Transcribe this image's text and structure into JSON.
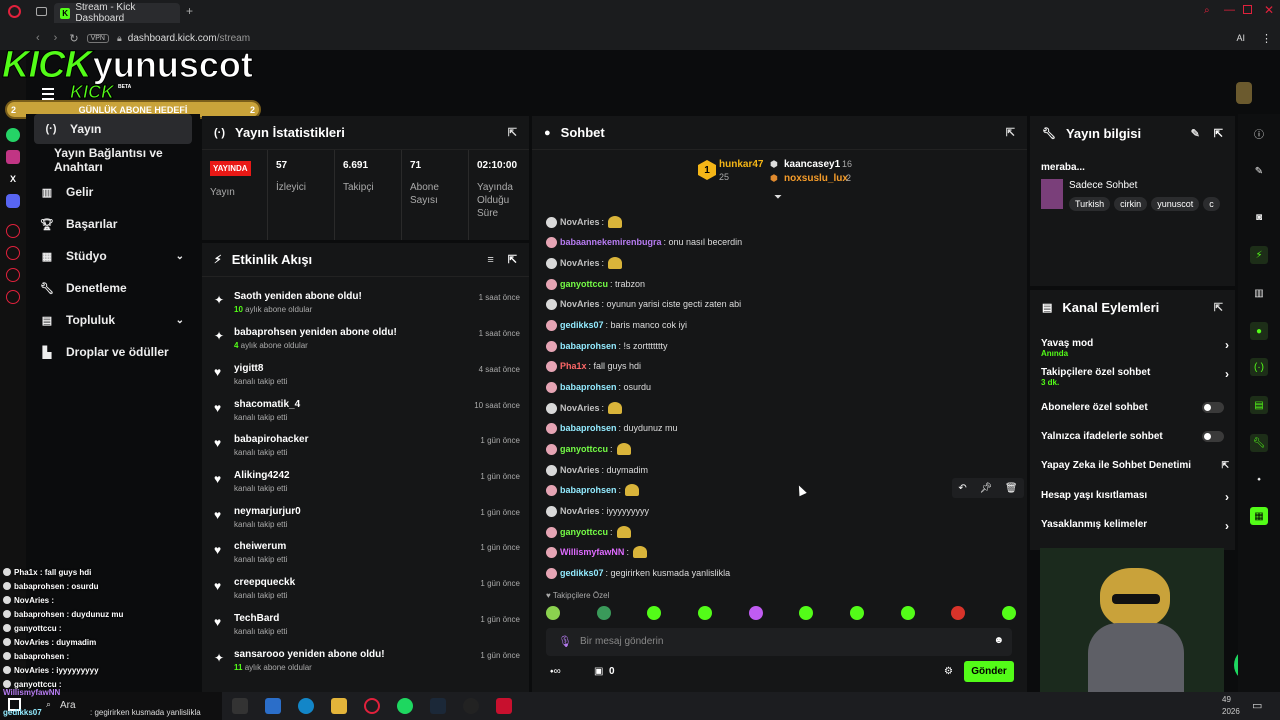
{
  "browser": {
    "tab_title": "Stream - Kick Dashboard",
    "tab_favicon": "K",
    "url_domain": "dashboard.kick.com",
    "url_path": "/stream",
    "vpn_badge": "VPN",
    "ai_label": "AI"
  },
  "overlay": {
    "brand": "KICK",
    "username": "yunuscot",
    "beta": "BETA",
    "goal_label": "GÜNLÜK ABONE HEDEFİ",
    "goal_left": "2",
    "goal_right": "2",
    "chat": [
      {
        "user": "Pha1x",
        "text": ": fall guys hdi",
        "color": "#ffffff"
      },
      {
        "user": "babaprohsen",
        "text": ": osurdu",
        "color": "#ffffff"
      },
      {
        "user": "NovAries",
        "text": ":",
        "color": "#ffffff"
      },
      {
        "user": "babaprohsen",
        "text": ": duydunuz mu",
        "color": "#ffffff"
      },
      {
        "user": "ganyottccu",
        "text": ":",
        "color": "#ffffff"
      },
      {
        "user": "NovAries",
        "text": ": duymadim",
        "color": "#ffffff"
      },
      {
        "user": "babaprohsen",
        "text": ":",
        "color": "#ffffff"
      },
      {
        "user": "NovAries",
        "text": ": iyyyyyyyyy",
        "color": "#ffffff"
      },
      {
        "user": "ganyottccu",
        "text": ":",
        "color": "#ffffff"
      }
    ]
  },
  "nav": {
    "items": [
      {
        "label": "Yayın",
        "icon": "broadcast-icon"
      },
      {
        "label": "Yayın Bağlantısı ve Anahtarı",
        "icon": ""
      },
      {
        "label": "Gelir",
        "icon": "revenue-icon"
      },
      {
        "label": "Başarılar",
        "icon": "trophy-icon"
      },
      {
        "label": "Stüdyo",
        "icon": "studio-icon"
      },
      {
        "label": "Denetleme",
        "icon": "wrench-icon"
      },
      {
        "label": "Topluluk",
        "icon": "community-icon"
      },
      {
        "label": "Droplar ve ödüller",
        "icon": "drops-icon"
      }
    ]
  },
  "stats": {
    "title": "Yayın İstatistikleri",
    "live_badge": "YAYINDA",
    "live_label": "Yayın",
    "viewers_value": "57",
    "viewers_label": "İzleyici",
    "followers_value": "6.691",
    "followers_label": "Takipçi",
    "subs_value": "71",
    "subs_label": "Abone Sayısı",
    "uptime_value": "02:10:00",
    "uptime_label": "Yayında Olduğu Süre"
  },
  "activity": {
    "title": "Etkinlik Akışı",
    "items": [
      {
        "title": "Saoth yeniden abone oldu!",
        "num": "10",
        "sub": " aylık abone oldular",
        "time": "1 saat önce",
        "icon": "sparkle-icon"
      },
      {
        "title": "babaprohsen yeniden abone oldu!",
        "num": "4",
        "sub": " aylık abone oldular",
        "time": "1 saat önce",
        "icon": "sparkle-icon"
      },
      {
        "title": "yigitt8",
        "num": "",
        "sub": "kanalı takip etti",
        "time": "4 saat önce",
        "icon": "heart-icon"
      },
      {
        "title": "shacomatik_4",
        "num": "",
        "sub": "kanalı takip etti",
        "time": "10 saat önce",
        "icon": "heart-icon"
      },
      {
        "title": "babapirohacker",
        "num": "",
        "sub": "kanalı takip etti",
        "time": "1 gün önce",
        "icon": "heart-icon"
      },
      {
        "title": "Aliking4242",
        "num": "",
        "sub": "kanalı takip etti",
        "time": "1 gün önce",
        "icon": "heart-icon"
      },
      {
        "title": "neymarjurjur0",
        "num": "",
        "sub": "kanalı takip etti",
        "time": "1 gün önce",
        "icon": "heart-icon"
      },
      {
        "title": "cheiwerum",
        "num": "",
        "sub": "kanalı takip etti",
        "time": "1 gün önce",
        "icon": "heart-icon"
      },
      {
        "title": "creepqueckk",
        "num": "",
        "sub": "kanalı takip etti",
        "time": "1 gün önce",
        "icon": "heart-icon"
      },
      {
        "title": "TechBard",
        "num": "",
        "sub": "kanalı takip etti",
        "time": "1 gün önce",
        "icon": "heart-icon"
      },
      {
        "title": "sansarooo yeniden abone oldu!",
        "num": "11",
        "sub": " aylık abone oldular",
        "time": "1 gün önce",
        "icon": "sparkle-icon"
      }
    ]
  },
  "chat": {
    "title": "Sohbet",
    "leaders": {
      "first_name": "hunkar47",
      "first_count": "25",
      "first_rank": "1",
      "second_name": "kaancasey1",
      "second_count": "16",
      "third_name": "noxsuslu_lux",
      "third_count": "2"
    },
    "messages": [
      {
        "user": "NovAries",
        "text": ":",
        "color": "#c0c0c0",
        "emote": true
      },
      {
        "user": "babaannekemirenbugra",
        "text": ": onu nasıl becerdin",
        "color": "#b77cf2",
        "emote": false
      },
      {
        "user": "NovAries",
        "text": ":",
        "color": "#c0c0c0",
        "emote": true
      },
      {
        "user": "ganyottccu",
        "text": ": trabzon",
        "color": "#75fd46",
        "emote": false
      },
      {
        "user": "NovAries",
        "text": ": oyunun yarisi ciste gecti zaten abi",
        "color": "#c0c0c0",
        "emote": false
      },
      {
        "user": "gedikks07",
        "text": ": baris manco cok iyi",
        "color": "#93ebff",
        "emote": false
      },
      {
        "user": "babaprohsen",
        "text": ": !s zorttttttty",
        "color": "#93ebff",
        "emote": false
      },
      {
        "user": "Pha1x",
        "text": ": fall guys hdi",
        "color": "#fc6767",
        "emote": false
      },
      {
        "user": "babaprohsen",
        "text": ": osurdu",
        "color": "#93ebff",
        "emote": false
      },
      {
        "user": "NovAries",
        "text": ":",
        "color": "#c0c0c0",
        "emote": true
      },
      {
        "user": "babaprohsen",
        "text": ": duydunuz mu",
        "color": "#93ebff",
        "emote": false
      },
      {
        "user": "ganyottccu",
        "text": ":",
        "color": "#75fd46",
        "emote": true
      },
      {
        "user": "NovAries",
        "text": ": duymadim",
        "color": "#c0c0c0",
        "emote": false
      },
      {
        "user": "babaprohsen",
        "text": ":",
        "color": "#93ebff",
        "emote": true
      },
      {
        "user": "NovAries",
        "text": ": iyyyyyyyyy",
        "color": "#c0c0c0",
        "emote": false
      },
      {
        "user": "ganyottccu",
        "text": ":",
        "color": "#75fd46",
        "emote": true
      },
      {
        "user": "WillismyfawNN",
        "text": ":",
        "color": "#de6bff",
        "emote": true
      },
      {
        "user": "gedikks07",
        "text": ": gegirirken kusmada yanlislikla",
        "color": "#93ebff",
        "emote": false
      }
    ],
    "followers_only_label": "Takipçilere Özel",
    "input_placeholder": "Bir mesaj gönderin",
    "points_value": "0",
    "send_label": "Gönder"
  },
  "info": {
    "title": "Yayın bilgisi",
    "stream_title": "meraba...",
    "category": "Sadece Sohbet",
    "tags": [
      "Turkish",
      "cirkin",
      "yunuscot",
      "c"
    ]
  },
  "channel_actions": {
    "title": "Kanal Eylemleri",
    "slow_mode": "Yavaş mod",
    "slow_mode_value": "Anında",
    "followers_chat": "Takipçilere özel sohbet",
    "followers_chat_value": "3 dk.",
    "subs_chat": "Abonelere özel sohbet",
    "emotes_chat": "Yalnızca ifadelerle sohbet",
    "ai_moderation": "Yapay Zeka ile Sohbet Denetimi",
    "age_restriction": "Hesap yaşı kısıtlaması",
    "banned_words": "Yasaklanmış kelimeler"
  },
  "taskbar": {
    "search_label": "Ara",
    "clock_partial_1": "49",
    "clock_partial_2": "2026",
    "overlay_bottom_user": "WillismyfawNN",
    "overlay_bottom_user2": "gedikks07",
    "overlay_bottom_text": ": gegirirken kusmada yanlislikla"
  },
  "colors": {
    "kick_green": "#53fc18",
    "live_red": "#e91916",
    "panel_bg": "#151617",
    "page_bg": "#0b0c0d"
  }
}
